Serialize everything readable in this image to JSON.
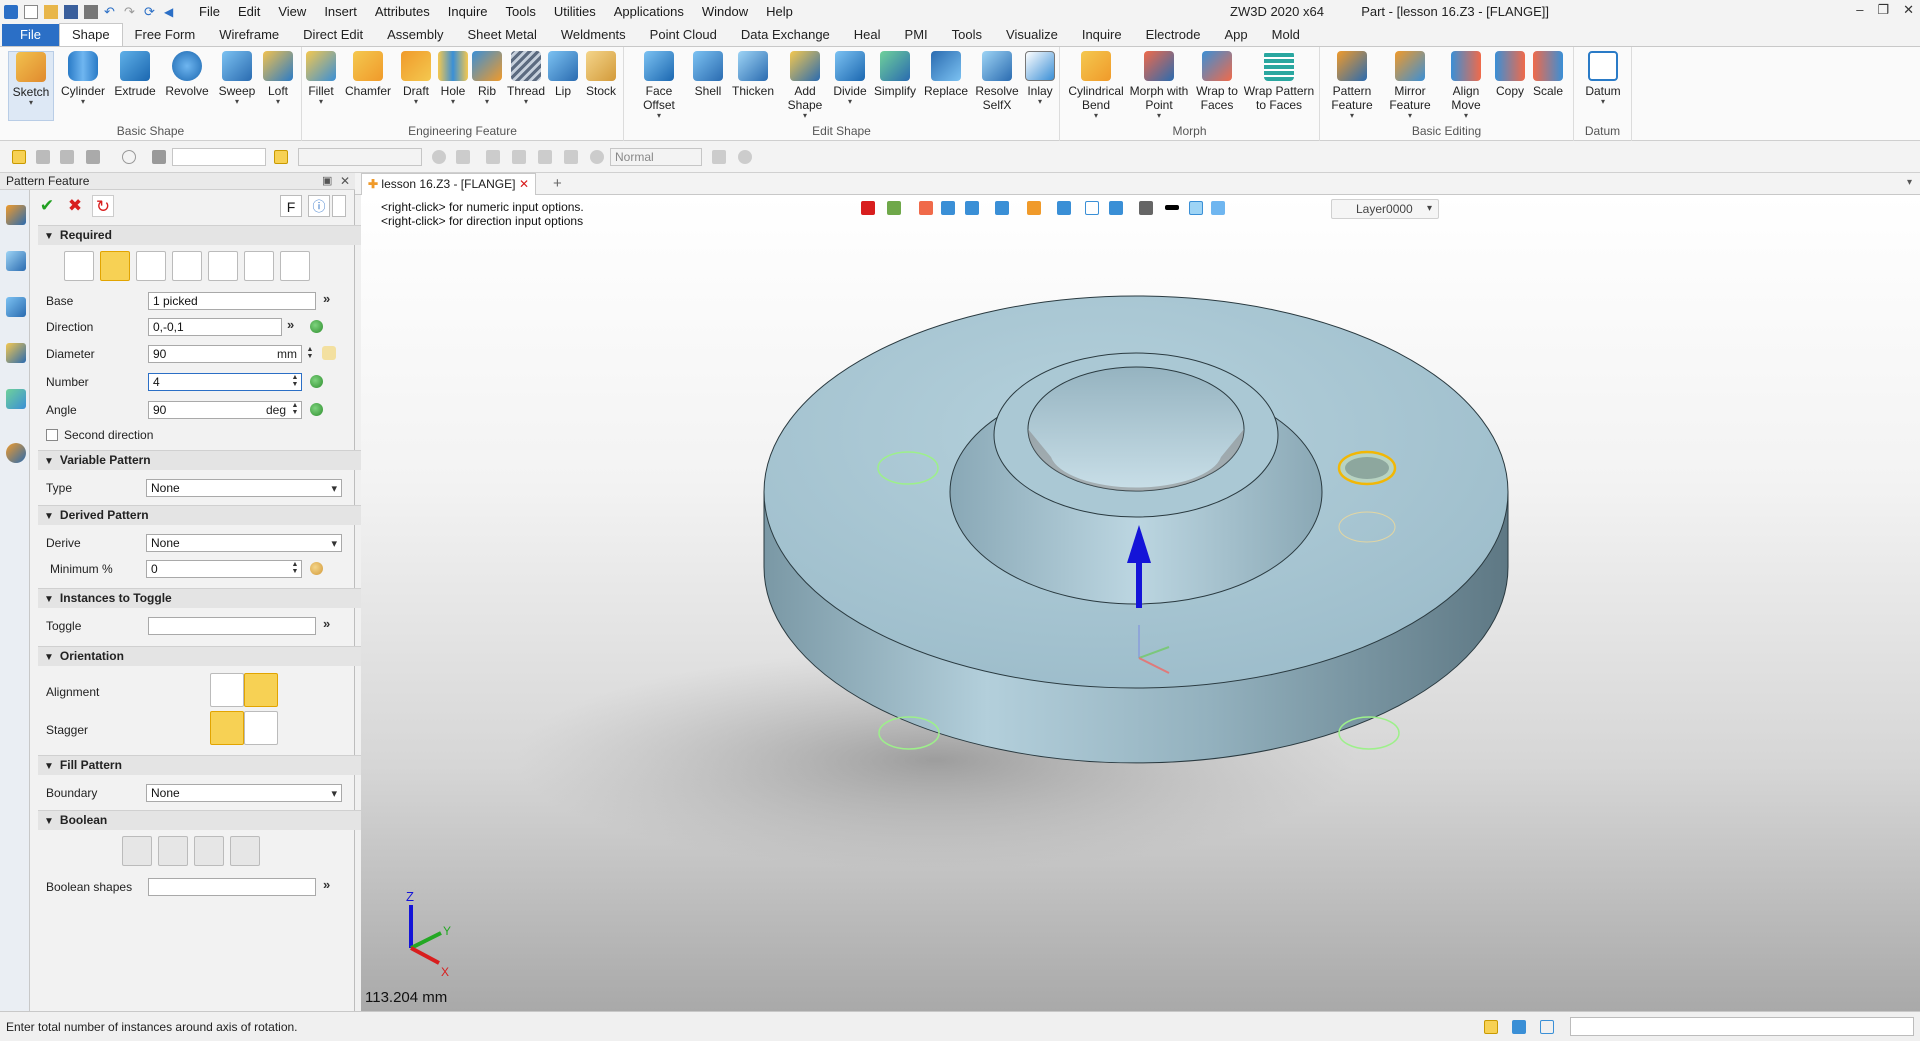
{
  "window": {
    "title": "ZW3D 2020 x64",
    "doc_title": "Part - [lesson 16.Z3 - [FLANGE]]"
  },
  "menu": [
    "File",
    "Edit",
    "View",
    "Insert",
    "Attributes",
    "Inquire",
    "Tools",
    "Utilities",
    "Applications",
    "Window",
    "Help"
  ],
  "tabs": [
    "File",
    "Shape",
    "Free Form",
    "Wireframe",
    "Direct Edit",
    "Assembly",
    "Sheet Metal",
    "Weldments",
    "Point Cloud",
    "Data Exchange",
    "Heal",
    "PMI",
    "Tools",
    "Visualize",
    "Inquire",
    "Electrode",
    "App",
    "Mold"
  ],
  "ribbon": {
    "basic_shape": {
      "label": "Basic Shape",
      "items": [
        "Sketch",
        "Cylinder",
        "Extrude",
        "Revolve",
        "Sweep",
        "Loft"
      ]
    },
    "engineering_feature": {
      "label": "Engineering Feature",
      "items": [
        "Fillet",
        "Chamfer",
        "Draft",
        "Hole",
        "Rib",
        "Thread",
        "Lip",
        "Stock"
      ]
    },
    "edit_shape": {
      "label": "Edit Shape",
      "items": [
        "Face Offset",
        "Shell",
        "Thicken",
        "Add Shape",
        "Divide",
        "Simplify",
        "Replace",
        "Resolve SelfX",
        "Inlay"
      ]
    },
    "morph": {
      "label": "Morph",
      "items": [
        "Cylindrical Bend",
        "Morph with Point",
        "Wrap to Faces",
        "Wrap Pattern to Faces"
      ]
    },
    "basic_editing": {
      "label": "Basic Editing",
      "items": [
        "Pattern Feature",
        "Mirror Feature",
        "Align Move",
        "Copy",
        "Scale"
      ]
    },
    "datum": {
      "label": "Datum",
      "items": [
        "Datum"
      ]
    }
  },
  "toolbar": {
    "render_mode": "Normal"
  },
  "panel": {
    "title": "Pattern Feature",
    "f_label": "F",
    "sections": {
      "required": "Required",
      "variable": "Variable Pattern",
      "derived": "Derived Pattern",
      "instances": "Instances to Toggle",
      "orientation": "Orientation",
      "fill": "Fill Pattern",
      "boolean": "Boolean"
    },
    "fields": {
      "base_label": "Base",
      "base_value": "1 picked",
      "direction_label": "Direction",
      "direction_value": "0,-0,1",
      "diameter_label": "Diameter",
      "diameter_value": "90",
      "diameter_unit": "mm",
      "number_label": "Number",
      "number_value": "4",
      "angle_label": "Angle",
      "angle_value": "90",
      "angle_unit": "deg",
      "second_direction": "Second direction",
      "type_label": "Type",
      "type_value": "None",
      "derive_label": "Derive",
      "derive_value": "None",
      "minimum_label": "Minimum %",
      "minimum_value": "0",
      "toggle_label": "Toggle",
      "alignment_label": "Alignment",
      "stagger_label": "Stagger",
      "boundary_label": "Boundary",
      "boundary_value": "None",
      "boolean_shapes_label": "Boolean shapes"
    }
  },
  "viewport": {
    "doc_tab": "lesson 16.Z3 - [FLANGE]",
    "hint1": "<right-click> for numeric input options.",
    "hint2": "<right-click> for direction input options",
    "layer": "Layer0000",
    "measure": "113.204 mm",
    "axes": {
      "x": "X",
      "y": "Y",
      "z": "Z"
    }
  },
  "status": {
    "text": "Enter total number of instances around axis of rotation."
  },
  "colors": {
    "accent": "#2b6fc6",
    "part": "#a9c7d3",
    "highlight": "#f2b705"
  }
}
